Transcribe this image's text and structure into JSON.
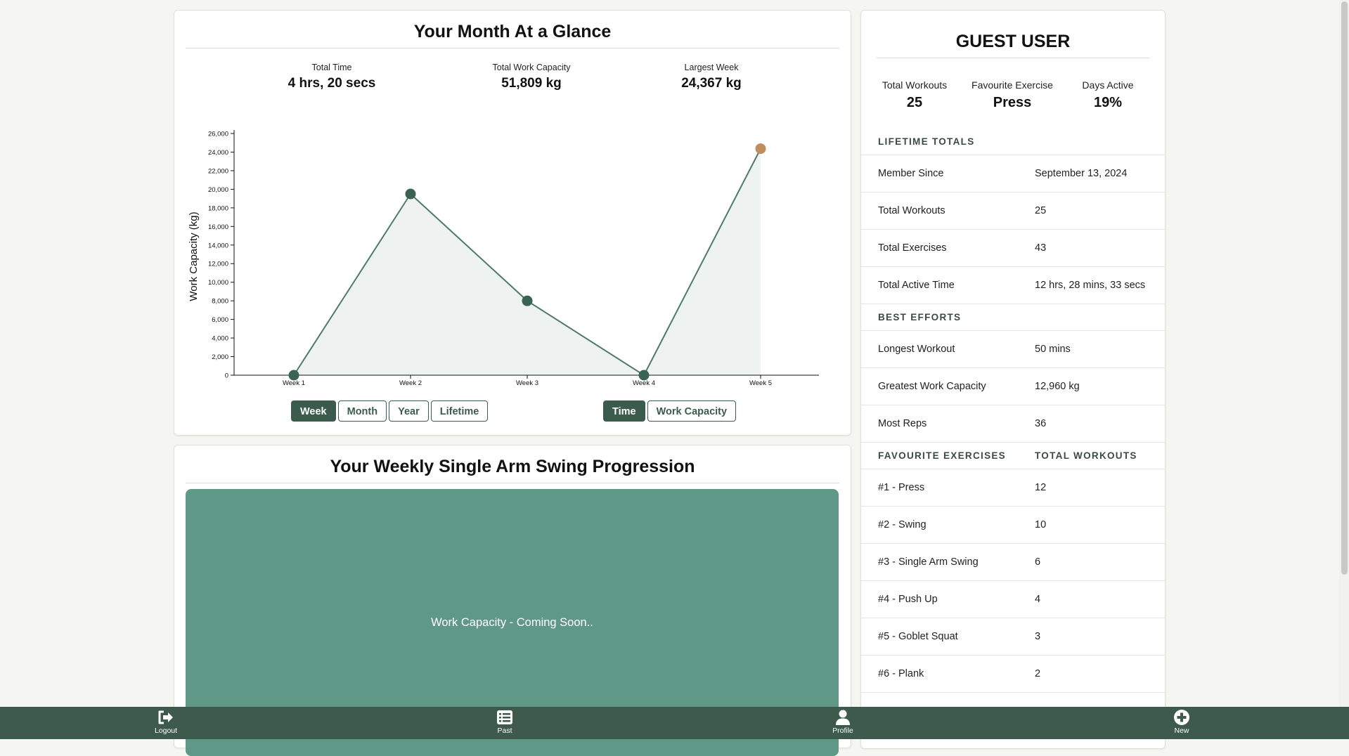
{
  "month": {
    "title": "Your Month At a Glance",
    "stats": [
      {
        "label": "Total Time",
        "value": "4 hrs, 20 secs"
      },
      {
        "label": "Total Work Capacity",
        "value": "51,809 kg"
      },
      {
        "label": "Largest Week",
        "value": "24,367 kg"
      }
    ],
    "range_buttons": [
      {
        "label": "Week",
        "active": false
      },
      {
        "label": "Month",
        "active": true
      },
      {
        "label": "Year",
        "active": false
      },
      {
        "label": "Lifetime",
        "active": false
      }
    ],
    "metric_buttons": [
      {
        "label": "Time",
        "active": false
      },
      {
        "label": "Work Capacity",
        "active": true
      }
    ]
  },
  "chart_data": {
    "type": "area",
    "categories": [
      "Week 1",
      "Week 2",
      "Week 3",
      "Week 4",
      "Week 5"
    ],
    "values": [
      0,
      19500,
      8000,
      0,
      24367
    ],
    "ylabel": "Work Capacity (kg)",
    "xlabel": "",
    "ylim": [
      0,
      26000
    ],
    "yticks": [
      "0",
      "2,000",
      "4,000",
      "6,000",
      "8,000",
      "10,000",
      "12,000",
      "14,000",
      "16,000",
      "18,000",
      "20,000",
      "22,000",
      "24,000",
      "26,000"
    ],
    "highlight_index": 4,
    "colors": {
      "line": "#4e7a67",
      "point": "#3b6354",
      "highlight": "#c08e5c",
      "fill": "#eef3f1"
    },
    "grid": false
  },
  "progression": {
    "title": "Your Weekly Single Arm Swing Progression",
    "placeholder": "Work Capacity - Coming Soon.."
  },
  "profile": {
    "title": "GUEST USER",
    "stats": [
      {
        "label": "Total Workouts",
        "value": "25"
      },
      {
        "label": "Favourite Exercise",
        "value": "Press"
      },
      {
        "label": "Days Active",
        "value": "19%"
      }
    ],
    "lifetime_heading": "LIFETIME TOTALS",
    "lifetime": [
      {
        "label": "Member Since",
        "value": "September 13, 2024"
      },
      {
        "label": "Total Workouts",
        "value": "25"
      },
      {
        "label": "Total Exercises",
        "value": "43"
      },
      {
        "label": "Total Active Time",
        "value": "12 hrs, 28 mins, 33 secs"
      }
    ],
    "best_heading": "BEST EFFORTS",
    "best": [
      {
        "label": "Longest Workout",
        "value": "50 mins"
      },
      {
        "label": "Greatest Work Capacity",
        "value": "12,960 kg"
      },
      {
        "label": "Most Reps",
        "value": "36"
      }
    ],
    "fav_heading": "FAVOURITE EXERCISES",
    "fav_heading_right": "TOTAL WORKOUTS",
    "favourites": [
      {
        "label": "#1 - Press",
        "value": "12"
      },
      {
        "label": "#2 - Swing",
        "value": "10"
      },
      {
        "label": "#3 - Single Arm Swing",
        "value": "6"
      },
      {
        "label": "#4 - Push Up",
        "value": "4"
      },
      {
        "label": "#5 - Goblet Squat",
        "value": "3"
      },
      {
        "label": "#6 - Plank",
        "value": "2"
      }
    ]
  },
  "nav": [
    {
      "label": "Logout",
      "icon": "logout-icon"
    },
    {
      "label": "Past",
      "icon": "list-icon"
    },
    {
      "label": "Profile",
      "icon": "person-icon"
    },
    {
      "label": "New",
      "icon": "plus-circle-icon"
    }
  ],
  "colors": {
    "accent": "#3b5b4c",
    "nav_bg": "#3d5a4c",
    "placeholder_bg": "#609888",
    "page_bg": "#f5f5f1"
  }
}
